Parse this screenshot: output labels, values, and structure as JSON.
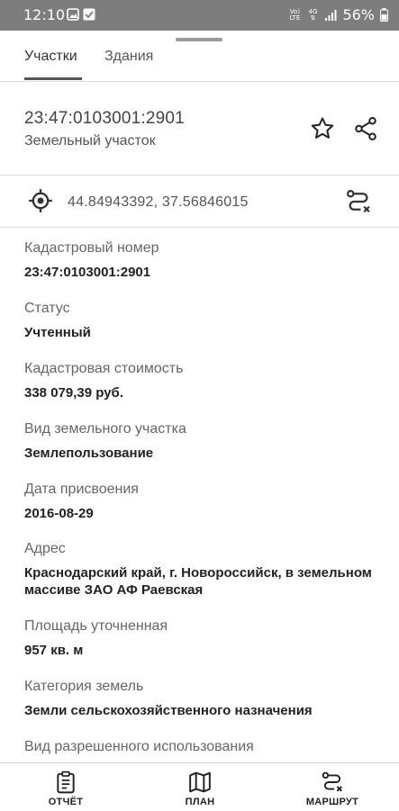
{
  "status_bar": {
    "time": "12:10",
    "signal_labels": [
      "Vo)",
      "LTE",
      "4G"
    ],
    "battery": "56%"
  },
  "tabs": [
    {
      "label": "Участки",
      "active": true
    },
    {
      "label": "Здания",
      "active": false
    }
  ],
  "parcel": {
    "id": "23:47:0103001:2901",
    "type": "Земельный участок"
  },
  "location": {
    "coordinates": "44.84943392, 37.56846015"
  },
  "fields": [
    {
      "label": "Кадастровый номер",
      "value": "23:47:0103001:2901"
    },
    {
      "label": "Статус",
      "value": "Учтенный"
    },
    {
      "label": "Кадастровая стоимость",
      "value": "338 079,39 руб."
    },
    {
      "label": "Вид земельного участка",
      "value": "Землепользование"
    },
    {
      "label": "Дата присвоения",
      "value": "2016-08-29"
    },
    {
      "label": "Адрес",
      "value": "Краснодарский край, г. Новороссийск, в земельном массиве ЗАО АФ Раевская"
    },
    {
      "label": "Площадь уточненная",
      "value": "957 кв. м"
    },
    {
      "label": "Категория земель",
      "value": "Земли сельскохозяйственного назначения"
    },
    {
      "label": "Вид разрешенного использования",
      "value": ""
    }
  ],
  "bottom_nav": [
    {
      "label": "ОТЧЁТ",
      "icon": "report-icon"
    },
    {
      "label": "ПЛАН",
      "icon": "map-icon"
    },
    {
      "label": "МАРШРУТ",
      "icon": "route-icon"
    }
  ]
}
